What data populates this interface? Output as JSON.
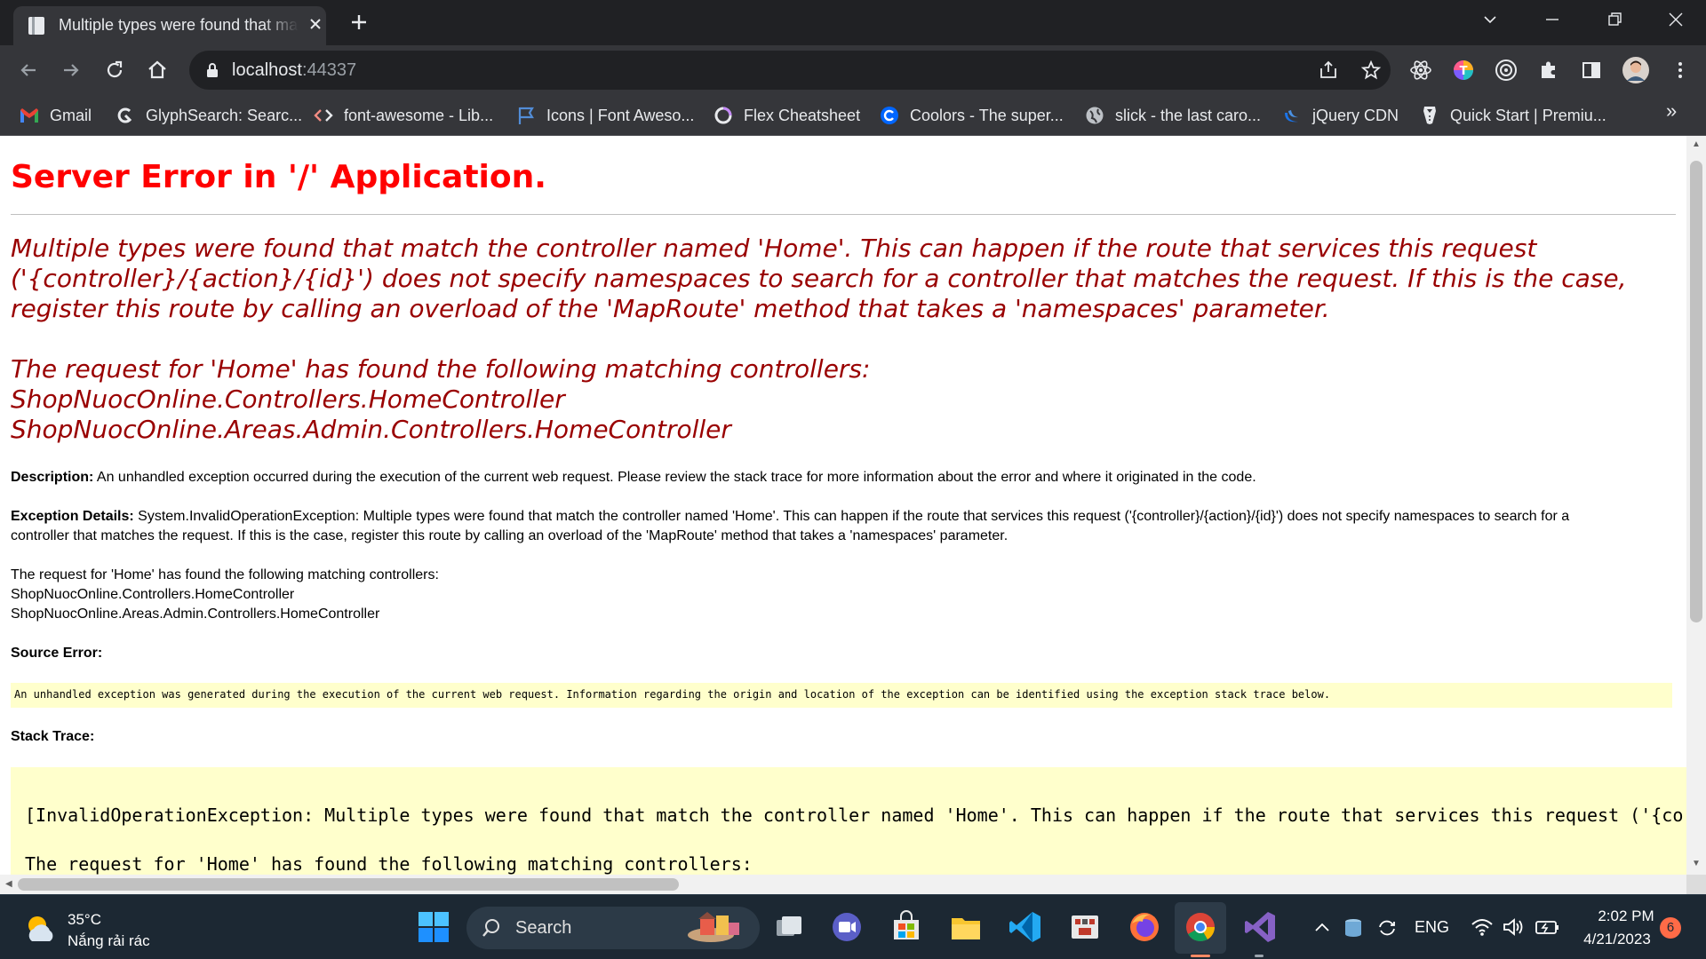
{
  "browser": {
    "tab_title": "Multiple types were found that match the controller named 'Home'",
    "url_host": "localhost",
    "url_port": ":44337",
    "bookmarks": [
      {
        "label": "Gmail",
        "icon": "gmail-icon"
      },
      {
        "label": "GlyphSearch: Searc...",
        "icon": "glyphsearch-icon"
      },
      {
        "label": "font-awesome - Lib...",
        "icon": "code-brackets-icon"
      },
      {
        "label": "Icons | Font Aweso...",
        "icon": "flag-icon"
      },
      {
        "label": "Flex Cheatsheet",
        "icon": "ring-icon"
      },
      {
        "label": "Coolors - The super...",
        "icon": "coolors-icon"
      },
      {
        "label": "slick - the last caro...",
        "icon": "globe-icon"
      },
      {
        "label": "jQuery CDN",
        "icon": "jquery-icon"
      },
      {
        "label": "Quick Start | Premiu...",
        "icon": "tuxedo-icon"
      }
    ],
    "bookmarks_more": "»"
  },
  "page": {
    "title": "Server Error in '/' Application.",
    "message_lines": [
      "Multiple types were found that match the controller named 'Home'. This can happen if the route that services this request",
      "('{controller}/{action}/{id}') does not specify namespaces to search for a controller that matches the request. If this is the case,",
      "register this route by calling an overload of the 'MapRoute' method that takes a 'namespaces' parameter."
    ],
    "matching_lines": [
      "The request for 'Home' has found the following matching controllers:",
      "ShopNuocOnline.Controllers.HomeController",
      "ShopNuocOnline.Areas.Admin.Controllers.HomeController"
    ],
    "description_label": "Description:",
    "description_text": " An unhandled exception occurred during the execution of the current web request. Please review the stack trace for more information about the error and where it originated in the code.",
    "exception_label": "Exception Details:",
    "exception_text_1": " System.InvalidOperationException: Multiple types were found that match the controller named 'Home'. This can happen if the route that services this request ('{controller}/{action}/{id}') does not specify namespaces to search for a",
    "exception_text_2": "controller that matches the request. If this is the case, register this route by calling an overload of the 'MapRoute' method that takes a 'namespaces' parameter.",
    "details_lines": [
      "The request for 'Home' has found the following matching controllers:",
      "ShopNuocOnline.Controllers.HomeController",
      "ShopNuocOnline.Areas.Admin.Controllers.HomeController"
    ],
    "source_error_label": "Source Error:",
    "source_error_text": "An unhandled exception was generated during the execution of the current web request. Information regarding the origin and location of the exception can be identified using the exception stack trace below.",
    "stack_trace_label": "Stack Trace:",
    "stack_lines": [
      "[InvalidOperationException: Multiple types were found that match the controller named 'Home'. This can happen if the route that services this request ('{co",
      "The request for 'Home' has found the following matching controllers:"
    ]
  },
  "taskbar": {
    "weather_temp": "35°C",
    "weather_desc": "Nắng rải rác",
    "search_label": "Search",
    "language": "ENG",
    "time": "2:02 PM",
    "date": "4/21/2023",
    "notification_count": "6"
  }
}
